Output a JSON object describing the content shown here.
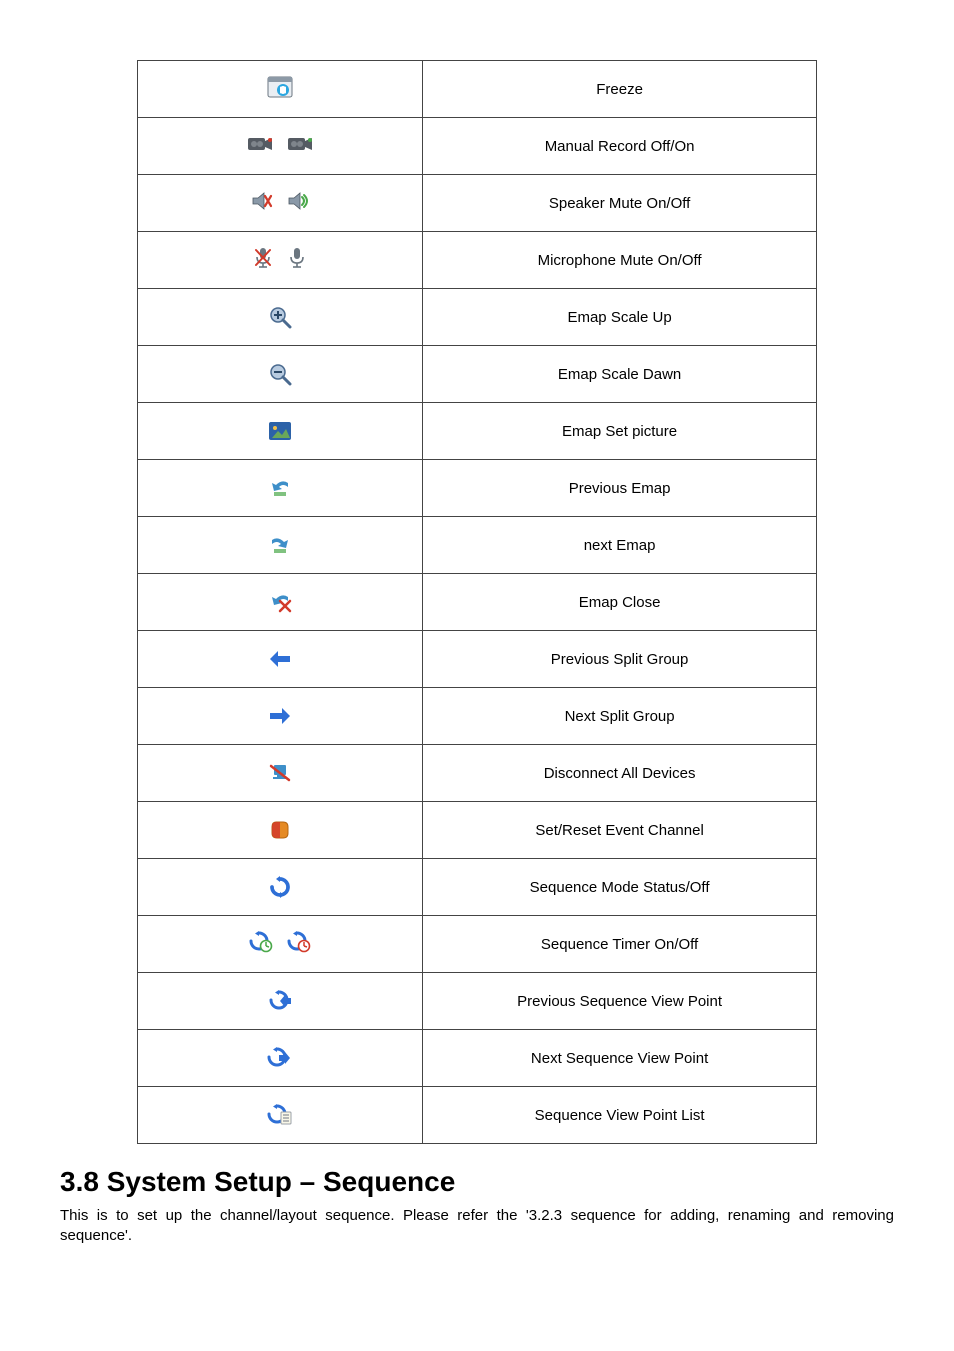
{
  "rows": [
    {
      "label": "Freeze"
    },
    {
      "label": "Manual Record Off/On"
    },
    {
      "label": "Speaker Mute On/Off"
    },
    {
      "label": "Microphone Mute On/Off"
    },
    {
      "label": "Emap Scale Up"
    },
    {
      "label": "Emap Scale Dawn"
    },
    {
      "label": "Emap Set picture"
    },
    {
      "label": "Previous Emap"
    },
    {
      "label": "next Emap"
    },
    {
      "label": "Emap Close"
    },
    {
      "label": "Previous Split Group"
    },
    {
      "label": "Next Split Group"
    },
    {
      "label": "Disconnect All Devices"
    },
    {
      "label": "Set/Reset Event Channel"
    },
    {
      "label": "Sequence Mode Status/Off"
    },
    {
      "label": "Sequence Timer On/Off"
    },
    {
      "label": "Previous Sequence View Point"
    },
    {
      "label": "Next Sequence View Point"
    },
    {
      "label": "Sequence View Point List"
    }
  ],
  "section": {
    "heading": "3.8 System Setup – Sequence",
    "body": "This is to set up the channel/layout sequence. Please refer the '3.2.3 sequence for adding, renaming and removing sequence'."
  },
  "icons": {
    "freeze": "freeze-icon",
    "record_off": "record-off-icon",
    "record_on": "record-on-icon",
    "speaker_mute": "speaker-mute-icon",
    "speaker_on": "speaker-on-icon",
    "mic_mute": "mic-mute-icon",
    "mic_on": "mic-on-icon",
    "zoom_in": "zoom-in-icon",
    "zoom_out": "zoom-out-icon",
    "picture": "picture-icon",
    "prev_emap": "prev-emap-icon",
    "next_emap": "next-emap-icon",
    "emap_close": "emap-close-icon",
    "arrow_left": "arrow-left-icon",
    "arrow_right": "arrow-right-icon",
    "disconnect": "disconnect-icon",
    "event_channel": "event-channel-icon",
    "seq_status": "sequence-status-icon",
    "seq_timer_on": "sequence-timer-on-icon",
    "seq_timer_off": "sequence-timer-off-icon",
    "seq_prev": "sequence-prev-icon",
    "seq_next": "sequence-next-icon",
    "seq_list": "sequence-list-icon"
  },
  "colors": {
    "blue": "#2e6fd6",
    "red": "#d23a2a",
    "orange": "#e58a24",
    "green": "#4aa84a",
    "gray": "#8a8f96",
    "black": "#1b1b1b",
    "cyan": "#3fb9c9"
  }
}
